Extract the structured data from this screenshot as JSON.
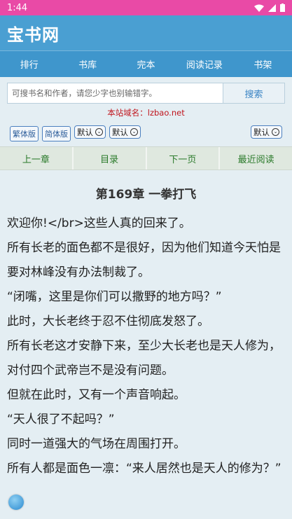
{
  "status": {
    "time": "1:44",
    "icons": [
      "wifi-icon",
      "signal-icon",
      "battery-icon"
    ]
  },
  "app": {
    "title": "宝书网"
  },
  "nav": [
    "排行",
    "书库",
    "完本",
    "阅读记录",
    "书架"
  ],
  "search": {
    "placeholder": "可搜书名和作者，请您少字也别输错字。",
    "button": "搜索"
  },
  "domain_notice": "本站域名：lzbao.net",
  "toolbar": {
    "traditional": "繁体版",
    "simplified": "简体版",
    "select1": "默认",
    "select2": "默认",
    "select3": "默认"
  },
  "chapter_nav": [
    "上一章",
    "目录",
    "下一页",
    "最近阅读"
  ],
  "chapter_title": "第169章 一拳打飞",
  "paragraphs": [
    "欢迎你!</br>这些人真的回来了。",
    "所有长老的面色都不是很好，因为他们知道今天怕是要对林峰没有办法制裁了。",
    "“闭嘴，这里是你们可以撒野的地方吗？”",
    "此时，大长老终于忍不住彻底发怒了。",
    "所有长老这才安静下来，至少大长老也是天人修为，对付四个武帝岂不是没有问题。",
    "但就在此时，又有一个声音响起。",
    "“天人很了不起吗？”",
    "同时一道强大的气场在周围打开。",
    "所有人都是面色一凛：“来人居然也是天人的修为？”"
  ],
  "colors": {
    "statusbar": "#e94aa6",
    "appbar": "#4a9fd2",
    "nav": "#3f96cc",
    "notice": "#c0141c",
    "chapter_nav_text": "#2a7a2a"
  }
}
